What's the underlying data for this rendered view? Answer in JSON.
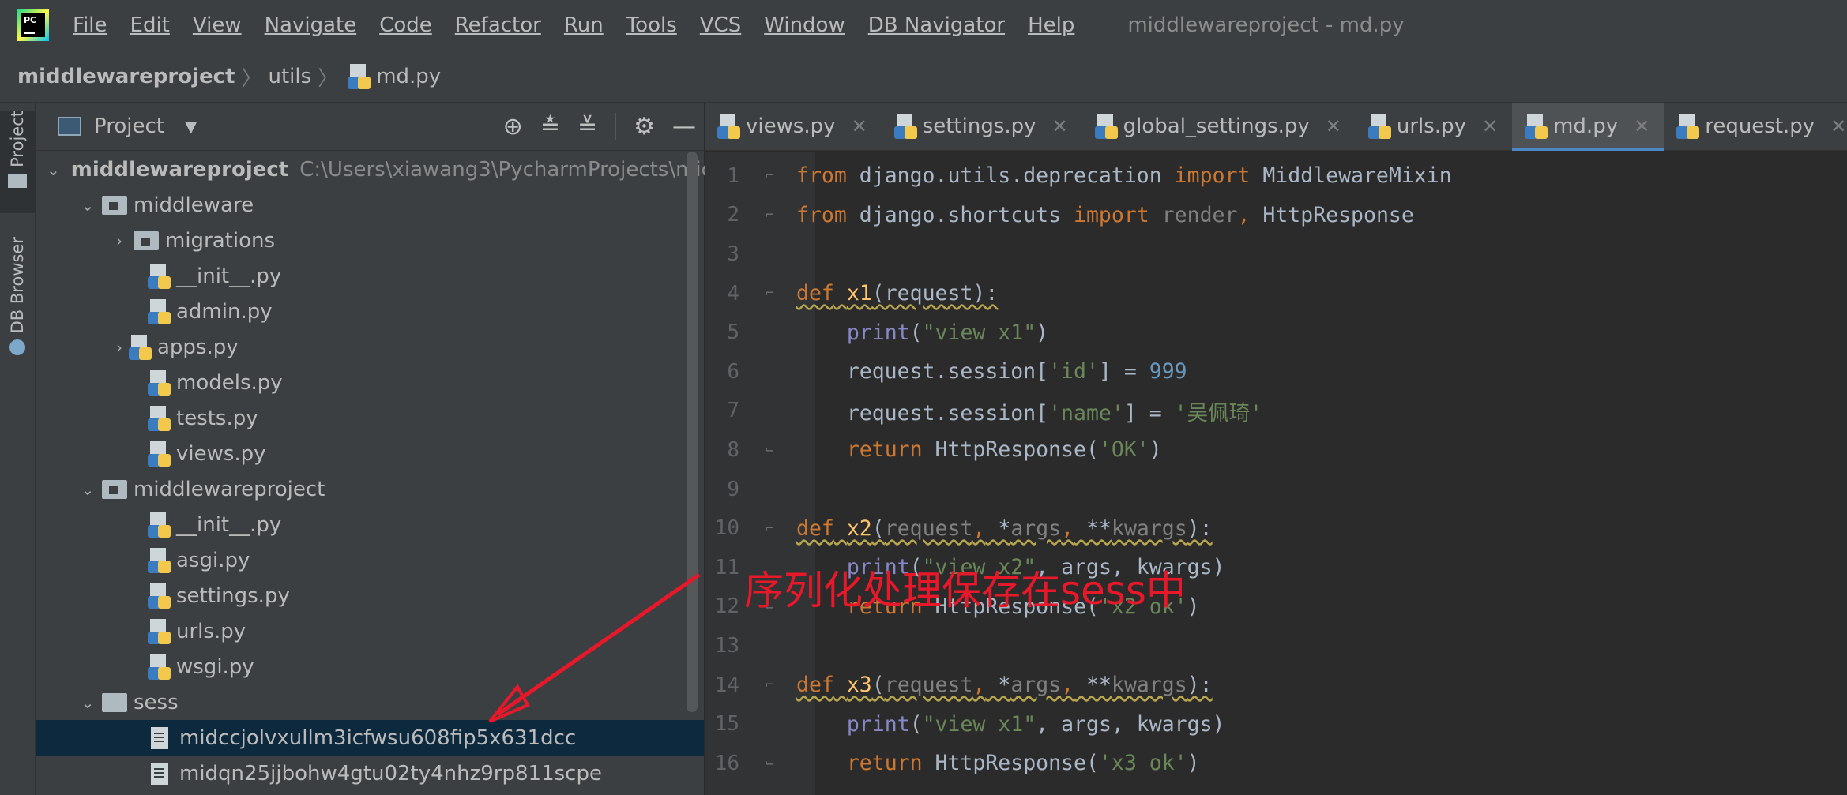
{
  "menubar": {
    "items": [
      "File",
      "Edit",
      "View",
      "Navigate",
      "Code",
      "Refactor",
      "Run",
      "Tools",
      "VCS",
      "Window",
      "DB Navigator",
      "Help"
    ],
    "window_title": "middlewareproject - md.py"
  },
  "breadcrumb": {
    "root": "middlewareproject",
    "folder": "utils",
    "file": "md.py"
  },
  "toolstrip": {
    "project_label": "Project",
    "db_label": "DB Browser"
  },
  "project_panel": {
    "title": "Project",
    "tree": [
      {
        "label": "middlewareproject",
        "hint": "C:\\Users\\xiawang3\\PycharmProjects\\midd"
      },
      {
        "label": "middleware"
      },
      {
        "label": "migrations"
      },
      {
        "label": "__init__.py"
      },
      {
        "label": "admin.py"
      },
      {
        "label": "apps.py"
      },
      {
        "label": "models.py"
      },
      {
        "label": "tests.py"
      },
      {
        "label": "views.py"
      },
      {
        "label": "middlewareproject"
      },
      {
        "label": "__init__.py"
      },
      {
        "label": "asgi.py"
      },
      {
        "label": "settings.py"
      },
      {
        "label": "urls.py"
      },
      {
        "label": "wsgi.py"
      },
      {
        "label": "sess"
      },
      {
        "label": "midccjolvxullm3icfwsu608fip5x631dcc"
      },
      {
        "label": "midqn25jjbohw4gtu02ty4nhz9rp811scpe"
      }
    ]
  },
  "editor": {
    "tabs": [
      "views.py",
      "settings.py",
      "global_settings.py",
      "urls.py",
      "md.py",
      "request.py"
    ],
    "active_tab": "md.py",
    "line_numbers": [
      "1",
      "2",
      "3",
      "4",
      "5",
      "6",
      "7",
      "8",
      "9",
      "10",
      "11",
      "12",
      "13",
      "14",
      "15",
      "16"
    ],
    "code_lines": [
      "from django.utils.deprecation import MiddlewareMixin",
      "from django.shortcuts import render, HttpResponse",
      "",
      "def x1(request):",
      "    print(\"view x1\")",
      "    request.session['id'] = 999",
      "    request.session['name'] = '吴佩琦'",
      "    return HttpResponse('OK')",
      "",
      "def x2(request, *args, **kwargs):",
      "    print(\"view x2\", args, kwargs)",
      "    return HttpResponse('x2 ok')",
      "",
      "def x3(request, *args, **kwargs):",
      "    print(\"view x1\", args, kwargs)",
      "    return HttpResponse('x3 ok')"
    ]
  },
  "annotation": {
    "text": "序列化处理保存在sess中",
    "color": "#e8182b"
  },
  "colors": {
    "keyword": "#cc7832",
    "function": "#ffc66d",
    "string": "#6a8759",
    "number": "#6897bb",
    "builtin": "#8888c6",
    "accent": "#4a88c7"
  }
}
